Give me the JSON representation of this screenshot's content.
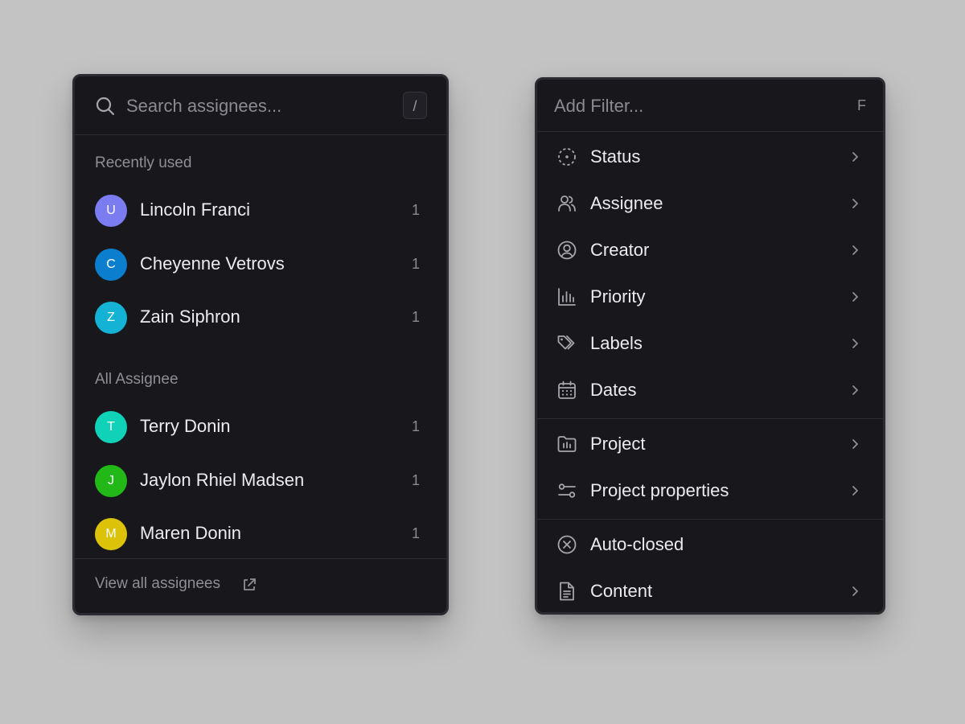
{
  "assignee_panel": {
    "search": {
      "placeholder": "Search assignees...",
      "shortcut": "/"
    },
    "recent_label": "Recently used",
    "recent": [
      {
        "initial": "U",
        "name": "Lincoln Franci",
        "count": "1",
        "color": "#7a7cf0"
      },
      {
        "initial": "C",
        "name": "Cheyenne Vetrovs",
        "count": "1",
        "color": "#0b7fce"
      },
      {
        "initial": "Z",
        "name": "Zain Siphron",
        "count": "1",
        "color": "#14b3d6"
      }
    ],
    "all_label": "All Assignee",
    "all": [
      {
        "initial": "T",
        "name": "Terry Donin",
        "count": "1",
        "color": "#10d2b8"
      },
      {
        "initial": "J",
        "name": "Jaylon Rhiel Madsen",
        "count": "1",
        "color": "#22b818"
      },
      {
        "initial": "M",
        "name": "Maren Donin",
        "count": "1",
        "color": "#dcc209"
      }
    ],
    "footer_link": "View all assignees"
  },
  "filter_panel": {
    "search": {
      "placeholder": "Add Filter...",
      "shortcut": "F"
    },
    "items": [
      {
        "label": "Status",
        "icon": "status-icon",
        "has_submenu": true
      },
      {
        "label": "Assignee",
        "icon": "users-icon",
        "has_submenu": true
      },
      {
        "label": "Creator",
        "icon": "user-circle-icon",
        "has_submenu": true
      },
      {
        "label": "Priority",
        "icon": "bar-chart-icon",
        "has_submenu": true
      },
      {
        "label": "Labels",
        "icon": "tags-icon",
        "has_submenu": true
      },
      {
        "label": "Dates",
        "icon": "calendar-icon",
        "has_submenu": true
      },
      {
        "label": "Project",
        "icon": "folder-chart-icon",
        "has_submenu": true
      },
      {
        "label": "Project properties",
        "icon": "sliders-icon",
        "has_submenu": true
      },
      {
        "label": "Auto-closed",
        "icon": "x-circle-icon",
        "has_submenu": false
      },
      {
        "label": "Content",
        "icon": "document-icon",
        "has_submenu": true
      }
    ]
  },
  "colors": {
    "background": "#c3c3c3",
    "panel": "#18181c",
    "text": "#ececee",
    "muted_text": "#8e8e94",
    "divider": "#2c2c32"
  }
}
